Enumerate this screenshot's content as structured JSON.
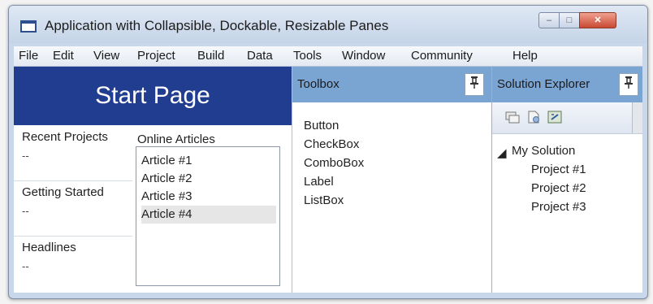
{
  "window": {
    "title": "Application with Collapsible, Dockable, Resizable Panes",
    "controls": {
      "minimize": "–",
      "maximize": "□",
      "close": "✕"
    }
  },
  "menu": [
    "File",
    "Edit",
    "View",
    "Project",
    "Build",
    "Data",
    "Tools",
    "Window",
    "Community",
    "Help"
  ],
  "start_page": {
    "banner": "Start Page",
    "sections": [
      {
        "title": "Recent Projects",
        "value": "--"
      },
      {
        "title": "Getting Started",
        "value": "--"
      },
      {
        "title": "Headlines",
        "value": "--"
      }
    ],
    "articles_title": "Online Articles",
    "articles": [
      "Article #1",
      "Article #2",
      "Article #3",
      "Article #4"
    ],
    "selected_article": "Article #4"
  },
  "toolbox": {
    "title": "Toolbox",
    "pin_icon": "pin-icon",
    "items": [
      "Button",
      "CheckBox",
      "ComboBox",
      "Label",
      "ListBox"
    ]
  },
  "solution_explorer": {
    "title": "Solution Explorer",
    "pin_icon": "pin-icon",
    "toolbar_icons": [
      "folder-icon",
      "document-icon",
      "refresh-icon"
    ],
    "tree": {
      "expander": "◢",
      "root": "My Solution",
      "children": [
        "Project #1",
        "Project #2",
        "Project #3"
      ]
    }
  },
  "colors": {
    "banner": "#213d8f",
    "pane_header": "#7aa5d3",
    "frame": "#c9d7ea"
  }
}
